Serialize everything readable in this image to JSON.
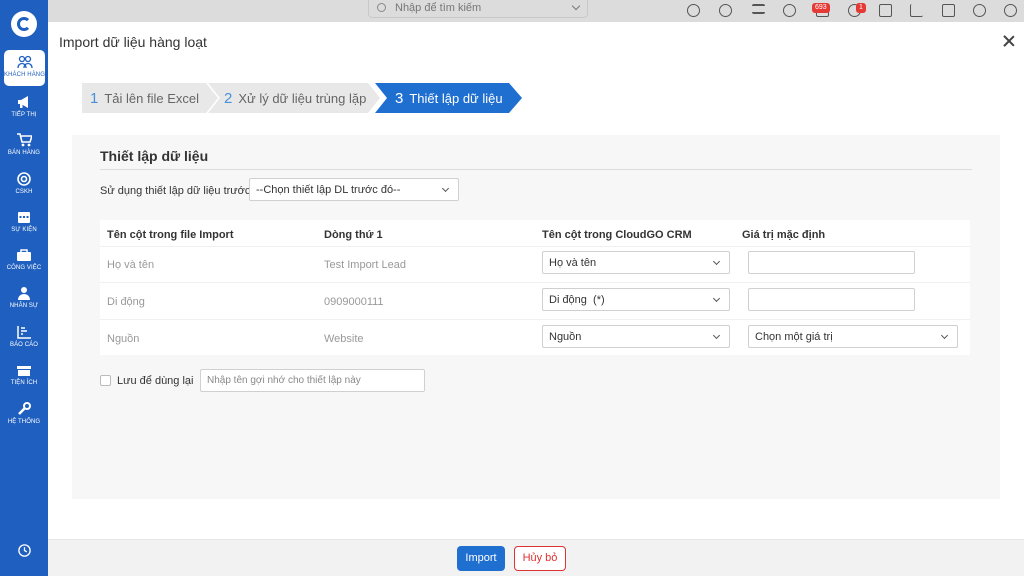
{
  "sidebar": {
    "items": [
      {
        "label": "KHÁCH HÀNG",
        "icon": "users-icon"
      },
      {
        "label": "TIẾP THỊ",
        "icon": "megaphone-icon"
      },
      {
        "label": "BÁN HÀNG",
        "icon": "cart-icon"
      },
      {
        "label": "CSKH",
        "icon": "lifebuoy-icon"
      },
      {
        "label": "SỰ KIỆN",
        "icon": "calendar-icon"
      },
      {
        "label": "CÔNG VIỆC",
        "icon": "briefcase-icon"
      },
      {
        "label": "NHÂN SỰ",
        "icon": "person-icon"
      },
      {
        "label": "BÁO CÁO",
        "icon": "report-icon"
      },
      {
        "label": "TIỆN ÍCH",
        "icon": "box-icon"
      },
      {
        "label": "HỆ THỐNG",
        "icon": "wrench-icon"
      }
    ]
  },
  "topbar": {
    "search_placeholder": "Nhập để tìm kiếm",
    "notif_count": "693",
    "chat_count": "1"
  },
  "modal": {
    "title": "Import dữ liệu hàng loạt",
    "steps": [
      {
        "num": "1",
        "label": "Tải lên file Excel"
      },
      {
        "num": "2",
        "label": "Xử lý dữ liệu trùng lặp"
      },
      {
        "num": "3",
        "label": "Thiết lập dữ liệu"
      }
    ],
    "panel": {
      "title": "Thiết lập dữ liệu",
      "setting_label": "Sử dụng thiết lập dữ liệu trước",
      "setting_select": "--Chọn thiết lập DL trước đó--",
      "columns": [
        "Tên cột trong file Import",
        "Dòng thứ 1",
        "Tên cột trong CloudGO CRM",
        "Giá trị mặc định"
      ],
      "rows": [
        {
          "import_col": "Họ và tên",
          "row1": "Test Import Lead",
          "crm_col": "Họ và tên",
          "default": ""
        },
        {
          "import_col": "Di động",
          "row1": "0909000111",
          "crm_col": "Di động  (*)",
          "default": ""
        },
        {
          "import_col": "Nguồn",
          "row1": "Website",
          "crm_col": "Nguồn",
          "default": "Chọn một giá trị"
        }
      ],
      "save_label": "Lưu để dùng lại",
      "save_placeholder": "Nhập tên gợi nhớ cho thiết lập này"
    },
    "buttons": {
      "import": "Import",
      "cancel": "Hủy bỏ"
    }
  },
  "colors": {
    "brand": "#1f5fbf",
    "primary": "#1f6fd1",
    "danger": "#d33333"
  }
}
